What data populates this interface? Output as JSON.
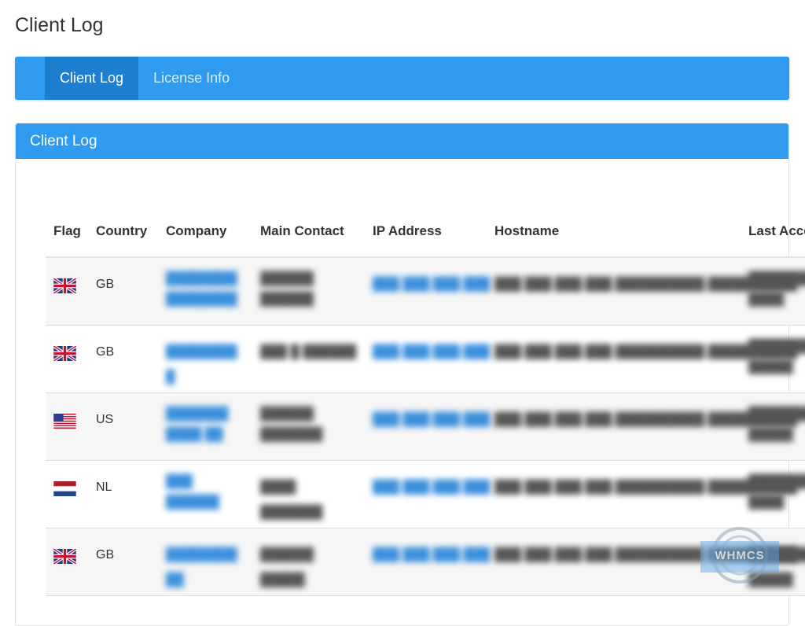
{
  "page": {
    "title": "Client Log"
  },
  "tabs": [
    {
      "label": "Client Log",
      "active": true
    },
    {
      "label": "License Info",
      "active": false
    }
  ],
  "panel": {
    "title": "Client Log"
  },
  "table": {
    "headers": [
      "Flag",
      "Country",
      "Company",
      "Main Contact",
      "IP Address",
      "Hostname",
      "Last Access"
    ],
    "rows": [
      {
        "flag": "gb-flag-icon",
        "country": "GB",
        "company": "████████ ████████",
        "contact": "██████ ██████",
        "ip": "███.███.███.███",
        "hostname": "███.███.███.███.██████████.██████████",
        "last_access": "██████████ ████"
      },
      {
        "flag": "gb-flag-icon",
        "country": "GB",
        "company": "████████ █",
        "contact": "███ █ ██████",
        "ip": "███.███.███.███",
        "hostname": "███.███.███.███.██████████.██████████",
        "last_access": "██████████ █████"
      },
      {
        "flag": "us-flag-icon",
        "country": "US",
        "company": "███████ ████ ██",
        "contact": "██████ ███████",
        "ip": "███.███.███.███",
        "hostname": "███.███.███.███.██████████.██████████",
        "last_access": "██████████ █████"
      },
      {
        "flag": "nl-flag-icon",
        "country": "NL",
        "company": "███ ██████",
        "contact": "████ ███████",
        "ip": "███.███.███.███",
        "hostname": "███.███.███.███.██████████.██████████",
        "last_access": "██████████ ████"
      },
      {
        "flag": "gb-flag-icon",
        "country": "GB",
        "company": "████████ ██",
        "contact": "██████ █████",
        "ip": "███.███.███.███",
        "hostname": "███.███.███.███.██████████.██████████",
        "last_access": "██████████ █████"
      }
    ]
  },
  "watermark": {
    "text": "WHMCS"
  },
  "colors": {
    "accent": "#2e9af0",
    "accent_dark": "#1c7fcf",
    "link": "#3a8fdc"
  }
}
